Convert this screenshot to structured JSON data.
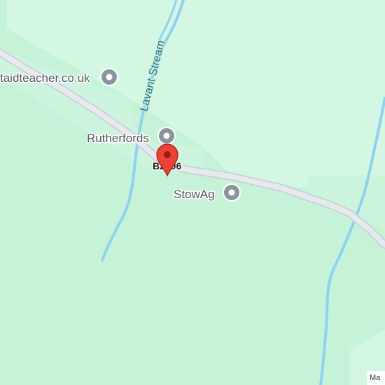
{
  "map": {
    "colors": {
      "land": "#c6f2d8",
      "land_light": "#d4f7e3",
      "road": "#e6e9ee",
      "road_casing": "#c7ccd3",
      "water": "#8ed3ee",
      "poi_gray": "#8b949c",
      "marker_red": "#ea4335",
      "marker_dark": "#a31a10"
    },
    "water_label": "Lavant Stream",
    "road_ref": "B2106",
    "pois": [
      {
        "name": "taidteacher.co.uk",
        "icon": "generic-poi-icon"
      },
      {
        "name": "Rutherfords",
        "icon": "generic-poi-icon"
      },
      {
        "name": "StowAg",
        "icon": "generic-poi-icon"
      }
    ],
    "marker": {
      "icon": "location-pin-icon"
    },
    "attribution": "Ma"
  }
}
